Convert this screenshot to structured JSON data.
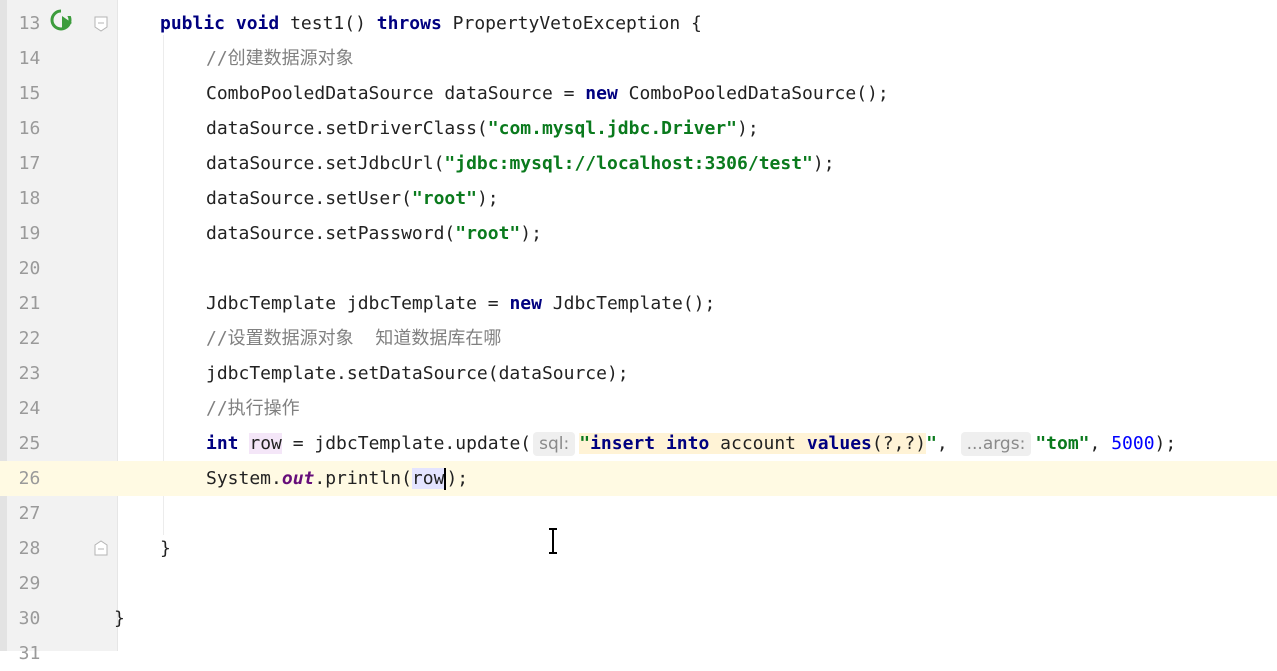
{
  "editor": {
    "lines": [
      {
        "num": "13",
        "segs": [
          {
            "t": "public",
            "c": "kw"
          },
          {
            "t": " "
          },
          {
            "t": "void",
            "c": "kw"
          },
          {
            "t": " test1() "
          },
          {
            "t": "throws",
            "c": "kw"
          },
          {
            "t": " PropertyVetoException {"
          }
        ]
      },
      {
        "num": "14",
        "indent": 2,
        "segs": [
          {
            "t": "//创建数据源对象",
            "c": "cmt"
          }
        ]
      },
      {
        "num": "15",
        "indent": 2,
        "segs": [
          {
            "t": "ComboPooledDataSource dataSource = "
          },
          {
            "t": "new",
            "c": "kw"
          },
          {
            "t": " ComboPooledDataSource();"
          }
        ]
      },
      {
        "num": "16",
        "indent": 2,
        "segs": [
          {
            "t": "dataSource.setDriverClass("
          },
          {
            "t": "\"com.mysql.jdbc.Driver\"",
            "c": "str"
          },
          {
            "t": ");"
          }
        ]
      },
      {
        "num": "17",
        "indent": 2,
        "segs": [
          {
            "t": "dataSource.setJdbcUrl("
          },
          {
            "t": "\"jdbc:mysql://localhost:3306/test\"",
            "c": "str"
          },
          {
            "t": ");"
          }
        ]
      },
      {
        "num": "18",
        "indent": 2,
        "segs": [
          {
            "t": "dataSource.setUser("
          },
          {
            "t": "\"root\"",
            "c": "str"
          },
          {
            "t": ");"
          }
        ]
      },
      {
        "num": "19",
        "indent": 2,
        "segs": [
          {
            "t": "dataSource.setPassword("
          },
          {
            "t": "\"root\"",
            "c": "str"
          },
          {
            "t": ");"
          }
        ]
      },
      {
        "num": "20",
        "segs": []
      },
      {
        "num": "21",
        "indent": 2,
        "segs": [
          {
            "t": "JdbcTemplate jdbcTemplate = "
          },
          {
            "t": "new",
            "c": "kw"
          },
          {
            "t": " JdbcTemplate();"
          }
        ]
      },
      {
        "num": "22",
        "indent": 2,
        "segs": [
          {
            "t": "//设置数据源对象  知道数据库在哪",
            "c": "cmt"
          }
        ]
      },
      {
        "num": "23",
        "indent": 2,
        "segs": [
          {
            "t": "jdbcTemplate.setDataSource(dataSource);"
          }
        ]
      },
      {
        "num": "24",
        "indent": 2,
        "segs": [
          {
            "t": "//执行操作",
            "c": "cmt"
          }
        ]
      },
      {
        "num": "25",
        "indent": 2,
        "segs": [
          {
            "t": "int",
            "c": "kw"
          },
          {
            "t": " "
          },
          {
            "t": "row",
            "c": "readvar"
          },
          {
            "t": " = jdbcTemplate.update("
          },
          {
            "t": "sql:",
            "c": "hint"
          },
          {
            "t": "\"",
            "c": "str inject"
          },
          {
            "t": "insert",
            "c": "kw inject"
          },
          {
            "t": " ",
            "c": "inject"
          },
          {
            "t": "into",
            "c": "kw inject"
          },
          {
            "t": " account ",
            "c": "inject"
          },
          {
            "t": "values",
            "c": "kw inject"
          },
          {
            "t": "(?,?)",
            "c": "inject"
          },
          {
            "t": "\"",
            "c": "str"
          },
          {
            "t": ", "
          },
          {
            "t": "...args:",
            "c": "hint"
          },
          {
            "t": "\"tom\"",
            "c": "str"
          },
          {
            "t": ", "
          },
          {
            "t": "5000",
            "c": "num"
          },
          {
            "t": ");"
          }
        ]
      },
      {
        "num": "26",
        "indent": 2,
        "current": true,
        "segs": [
          {
            "t": "System."
          },
          {
            "t": "out",
            "c": "field"
          },
          {
            "t": ".println("
          },
          {
            "t": "row",
            "c": "sel-row"
          },
          {
            "t": "",
            "c": "caret"
          },
          {
            "t": ");"
          }
        ]
      },
      {
        "num": "27",
        "segs": []
      },
      {
        "num": "28",
        "segs": [
          {
            "t": "}"
          }
        ]
      },
      {
        "num": "29",
        "segs": []
      },
      {
        "num": "30",
        "indent": 0,
        "segs": [
          {
            "t": "}"
          }
        ]
      },
      {
        "num": "31",
        "segs": []
      }
    ]
  },
  "colors": {
    "keyword": "#000080",
    "string": "#0a7a1d",
    "comment": "#808080",
    "number": "#0000ff",
    "current_line": "#fffae3"
  },
  "icons": {
    "run": "run-gutter-icon",
    "fold": "fold-icon",
    "cursor": "i-beam-cursor-icon"
  }
}
